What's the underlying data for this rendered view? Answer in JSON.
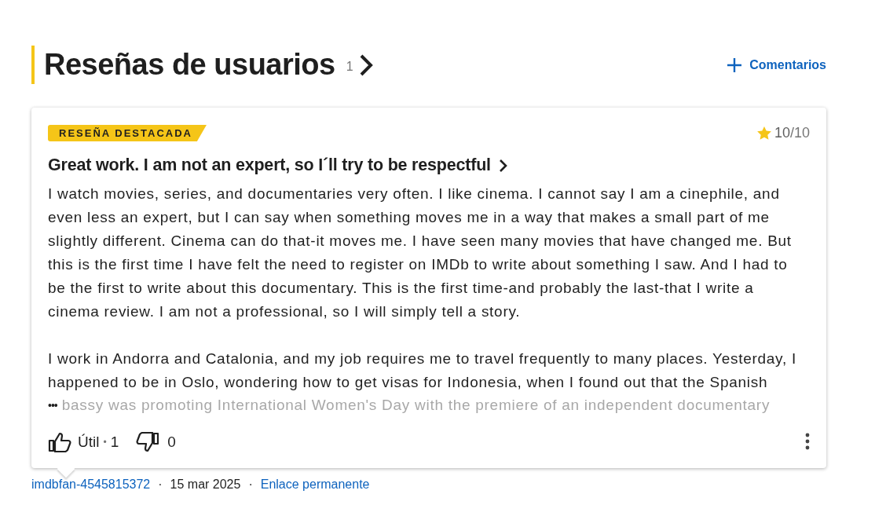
{
  "section": {
    "title": "Reseñas de usuarios",
    "count": "1",
    "action": "Comentarios"
  },
  "review": {
    "badge": "RESEÑA DESTACADA",
    "rating": "10",
    "rating_max": "/10",
    "title": "Great work. I am not an expert, so I´ll try to be respectful",
    "paragraphs": [
      "I watch movies, series, and documentaries very often. I like cinema. I cannot say I am a cinephile, and even less an expert, but I can say when something moves me in a way that makes a small part of me slightly different. Cinema can do that-it moves me. I have seen many movies that have changed me. But this is the first time I have felt the need to register on IMDb to write about something I saw. And I had to be the first to write about this documentary. This is the first time-and probably the last-that I write a cinema review. I am not a professional, so I will simply tell a story.",
      "I work in Andorra and Catalonia, and my job requires me to travel frequently to many places. Yesterday, I happened to be in Oslo, wondering how to get visas for Indonesia, when I found out that the Spanish"
    ],
    "faded_line": "bassy was promoting International Women's Day with the premiere of an independent documentary",
    "expand": "•••",
    "helpful_label": "Útil",
    "helpful_sep": "•",
    "helpful_count": "1",
    "unhelpful_count": "0"
  },
  "footer": {
    "author": "imdbfan-4545815372",
    "sep1": "·",
    "date": "15 mar 2025",
    "sep2": "·",
    "permalink": "Enlace permanente"
  }
}
